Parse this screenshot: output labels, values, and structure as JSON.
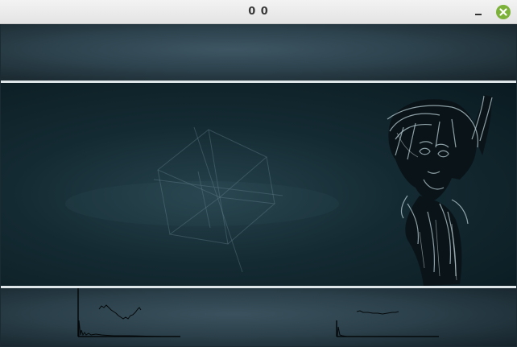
{
  "window": {
    "title": "0 0"
  },
  "controls": {
    "minimize_icon": "minimize-icon",
    "close_icon": "close-icon",
    "close_color": "#7db23a"
  },
  "visuals": {
    "background_accent": "#2d434e",
    "separator_color": "#dfe6ea"
  }
}
